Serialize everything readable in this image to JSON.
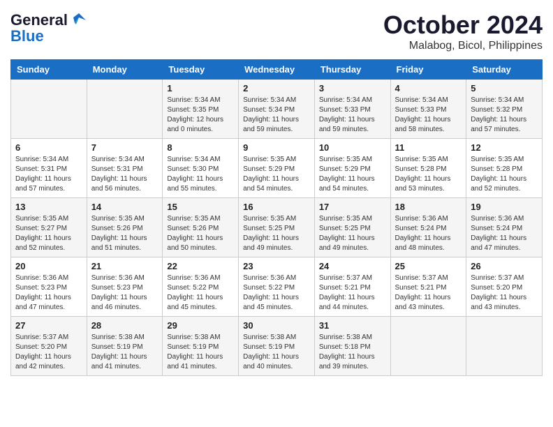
{
  "header": {
    "logo_line1": "General",
    "logo_line2": "Blue",
    "month_title": "October 2024",
    "location": "Malabog, Bicol, Philippines"
  },
  "weekdays": [
    "Sunday",
    "Monday",
    "Tuesday",
    "Wednesday",
    "Thursday",
    "Friday",
    "Saturday"
  ],
  "weeks": [
    [
      {
        "day": "",
        "content": ""
      },
      {
        "day": "",
        "content": ""
      },
      {
        "day": "1",
        "content": "Sunrise: 5:34 AM\nSunset: 5:35 PM\nDaylight: 12 hours\nand 0 minutes."
      },
      {
        "day": "2",
        "content": "Sunrise: 5:34 AM\nSunset: 5:34 PM\nDaylight: 11 hours\nand 59 minutes."
      },
      {
        "day": "3",
        "content": "Sunrise: 5:34 AM\nSunset: 5:33 PM\nDaylight: 11 hours\nand 59 minutes."
      },
      {
        "day": "4",
        "content": "Sunrise: 5:34 AM\nSunset: 5:33 PM\nDaylight: 11 hours\nand 58 minutes."
      },
      {
        "day": "5",
        "content": "Sunrise: 5:34 AM\nSunset: 5:32 PM\nDaylight: 11 hours\nand 57 minutes."
      }
    ],
    [
      {
        "day": "6",
        "content": "Sunrise: 5:34 AM\nSunset: 5:31 PM\nDaylight: 11 hours\nand 57 minutes."
      },
      {
        "day": "7",
        "content": "Sunrise: 5:34 AM\nSunset: 5:31 PM\nDaylight: 11 hours\nand 56 minutes."
      },
      {
        "day": "8",
        "content": "Sunrise: 5:34 AM\nSunset: 5:30 PM\nDaylight: 11 hours\nand 55 minutes."
      },
      {
        "day": "9",
        "content": "Sunrise: 5:35 AM\nSunset: 5:29 PM\nDaylight: 11 hours\nand 54 minutes."
      },
      {
        "day": "10",
        "content": "Sunrise: 5:35 AM\nSunset: 5:29 PM\nDaylight: 11 hours\nand 54 minutes."
      },
      {
        "day": "11",
        "content": "Sunrise: 5:35 AM\nSunset: 5:28 PM\nDaylight: 11 hours\nand 53 minutes."
      },
      {
        "day": "12",
        "content": "Sunrise: 5:35 AM\nSunset: 5:28 PM\nDaylight: 11 hours\nand 52 minutes."
      }
    ],
    [
      {
        "day": "13",
        "content": "Sunrise: 5:35 AM\nSunset: 5:27 PM\nDaylight: 11 hours\nand 52 minutes."
      },
      {
        "day": "14",
        "content": "Sunrise: 5:35 AM\nSunset: 5:26 PM\nDaylight: 11 hours\nand 51 minutes."
      },
      {
        "day": "15",
        "content": "Sunrise: 5:35 AM\nSunset: 5:26 PM\nDaylight: 11 hours\nand 50 minutes."
      },
      {
        "day": "16",
        "content": "Sunrise: 5:35 AM\nSunset: 5:25 PM\nDaylight: 11 hours\nand 49 minutes."
      },
      {
        "day": "17",
        "content": "Sunrise: 5:35 AM\nSunset: 5:25 PM\nDaylight: 11 hours\nand 49 minutes."
      },
      {
        "day": "18",
        "content": "Sunrise: 5:36 AM\nSunset: 5:24 PM\nDaylight: 11 hours\nand 48 minutes."
      },
      {
        "day": "19",
        "content": "Sunrise: 5:36 AM\nSunset: 5:24 PM\nDaylight: 11 hours\nand 47 minutes."
      }
    ],
    [
      {
        "day": "20",
        "content": "Sunrise: 5:36 AM\nSunset: 5:23 PM\nDaylight: 11 hours\nand 47 minutes."
      },
      {
        "day": "21",
        "content": "Sunrise: 5:36 AM\nSunset: 5:23 PM\nDaylight: 11 hours\nand 46 minutes."
      },
      {
        "day": "22",
        "content": "Sunrise: 5:36 AM\nSunset: 5:22 PM\nDaylight: 11 hours\nand 45 minutes."
      },
      {
        "day": "23",
        "content": "Sunrise: 5:36 AM\nSunset: 5:22 PM\nDaylight: 11 hours\nand 45 minutes."
      },
      {
        "day": "24",
        "content": "Sunrise: 5:37 AM\nSunset: 5:21 PM\nDaylight: 11 hours\nand 44 minutes."
      },
      {
        "day": "25",
        "content": "Sunrise: 5:37 AM\nSunset: 5:21 PM\nDaylight: 11 hours\nand 43 minutes."
      },
      {
        "day": "26",
        "content": "Sunrise: 5:37 AM\nSunset: 5:20 PM\nDaylight: 11 hours\nand 43 minutes."
      }
    ],
    [
      {
        "day": "27",
        "content": "Sunrise: 5:37 AM\nSunset: 5:20 PM\nDaylight: 11 hours\nand 42 minutes."
      },
      {
        "day": "28",
        "content": "Sunrise: 5:38 AM\nSunset: 5:19 PM\nDaylight: 11 hours\nand 41 minutes."
      },
      {
        "day": "29",
        "content": "Sunrise: 5:38 AM\nSunset: 5:19 PM\nDaylight: 11 hours\nand 41 minutes."
      },
      {
        "day": "30",
        "content": "Sunrise: 5:38 AM\nSunset: 5:19 PM\nDaylight: 11 hours\nand 40 minutes."
      },
      {
        "day": "31",
        "content": "Sunrise: 5:38 AM\nSunset: 5:18 PM\nDaylight: 11 hours\nand 39 minutes."
      },
      {
        "day": "",
        "content": ""
      },
      {
        "day": "",
        "content": ""
      }
    ]
  ]
}
